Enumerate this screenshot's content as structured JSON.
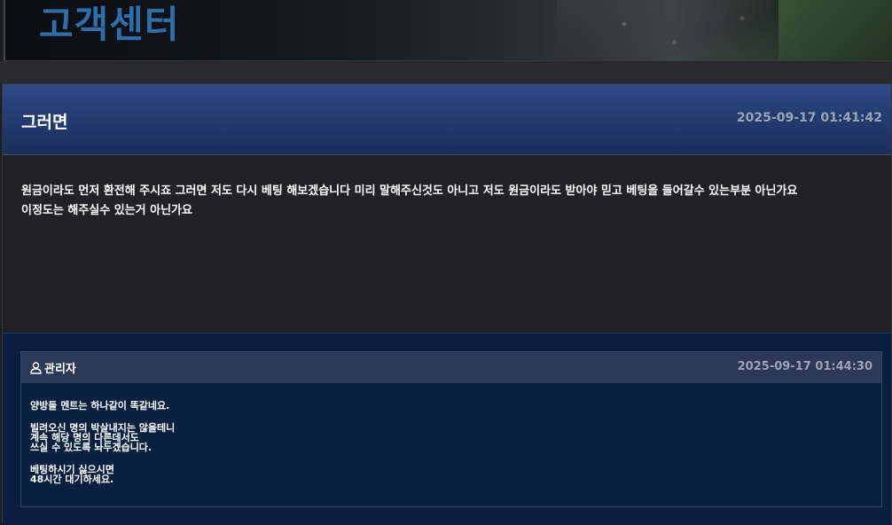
{
  "banner": {
    "title": "고객센터"
  },
  "post": {
    "title": "그러면",
    "date": "2025-09-17 01:41:42",
    "body_line1": "원금이라도 먼저 환전해 주시죠 그러면 저도 다시 베팅 해보겠습니다 미리 말해주신것도 아니고 저도 원금이라도 받아야 믿고 베팅을 들어갈수 있는부분 아닌가요",
    "body_line2": "이정도는 해주실수 있는거 아닌가요"
  },
  "reply": {
    "author": "관리자",
    "author_icon": "user-icon",
    "date": "2025-09-17 01:44:30",
    "paragraphs": [
      "양방들 멘트는 하나같이 똑같네요.",
      "빌려오신 명의 박살내지는 않을테니\n계속 해당 명의 다른데서도\n쓰실 수 있도록 놔두겠습니다.",
      "베팅하시기 싫으시면\n48시간 대기하세요."
    ]
  },
  "colors": {
    "background": "#1e1e22",
    "header_blue": "#233c72",
    "reply_bg": "#0a1f3e",
    "banner_title": "#2f6ea8"
  }
}
